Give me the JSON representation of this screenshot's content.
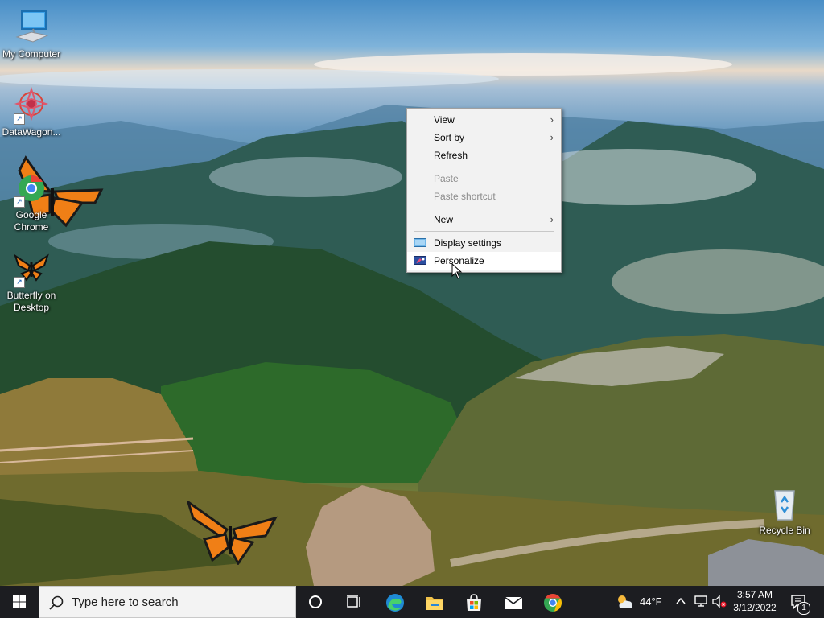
{
  "desktop": {
    "icons": [
      {
        "label": "My Computer",
        "icon": "computer-icon"
      },
      {
        "label": "DataWagon...",
        "icon": "datawagon-icon"
      },
      {
        "label": "Google Chrome",
        "icon": "chrome-icon"
      },
      {
        "label": "Butterfly on Desktop",
        "icon": "butterfly-icon"
      },
      {
        "label": "Recycle Bin",
        "icon": "recycle-bin-icon"
      }
    ]
  },
  "context_menu": {
    "items": [
      {
        "label": "View",
        "submenu": true
      },
      {
        "label": "Sort by",
        "submenu": true
      },
      {
        "label": "Refresh"
      },
      {
        "label": "Paste",
        "disabled": true
      },
      {
        "label": "Paste shortcut",
        "disabled": true
      },
      {
        "label": "New",
        "submenu": true
      },
      {
        "label": "Display settings",
        "icon": "display-icon"
      },
      {
        "label": "Personalize",
        "icon": "personalize-icon",
        "hovered": true
      }
    ]
  },
  "taskbar": {
    "search_placeholder": "Type here to search",
    "pinned": [
      "cortana-icon",
      "task-view-icon",
      "edge-icon",
      "file-explorer-icon",
      "microsoft-store-icon",
      "mail-icon",
      "chrome-icon"
    ],
    "weather": {
      "temp": "44°F",
      "icon": "partly-cloudy-icon"
    },
    "tray_icons": [
      "chevron-up-icon",
      "network-icon",
      "volume-muted-icon"
    ],
    "clock": {
      "time": "3:57 AM",
      "date": "3/12/2022"
    },
    "notifications": {
      "count": "1"
    }
  },
  "colors": {
    "taskbar": "#1c1d21",
    "menu_bg": "#f2f2f2",
    "accent": "#0078d7"
  }
}
